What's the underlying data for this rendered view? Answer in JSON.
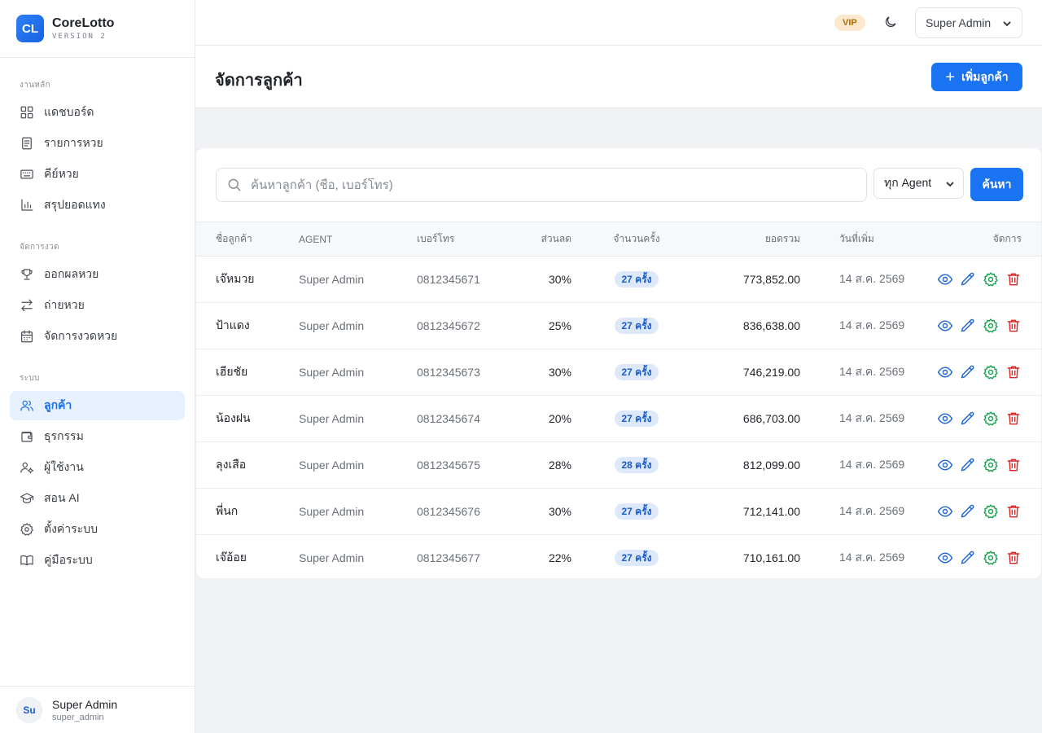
{
  "brand": {
    "logo": "CL",
    "name": "CoreLotto",
    "version": "VERSION 2"
  },
  "sidebar": {
    "sections": [
      {
        "title": "งานหลัก",
        "items": [
          {
            "label": "แดชบอร์ด",
            "icon": "dashboard-icon"
          },
          {
            "label": "รายการหวย",
            "icon": "document-icon"
          },
          {
            "label": "คีย์หวย",
            "icon": "keyboard-icon"
          },
          {
            "label": "สรุปยอดแทง",
            "icon": "bar-chart-icon"
          }
        ]
      },
      {
        "title": "จัดการงวด",
        "items": [
          {
            "label": "ออกผลหวย",
            "icon": "trophy-icon"
          },
          {
            "label": "ถ่ายหวย",
            "icon": "transfer-icon"
          },
          {
            "label": "จัดการงวดหวย",
            "icon": "calendar-icon"
          }
        ]
      },
      {
        "title": "ระบบ",
        "items": [
          {
            "label": "ลูกค้า",
            "icon": "users-icon",
            "active": true
          },
          {
            "label": "ธุรกรรม",
            "icon": "wallet-icon"
          },
          {
            "label": "ผู้ใช้งาน",
            "icon": "user-cog-icon"
          },
          {
            "label": "สอน AI",
            "icon": "graduation-cap-icon"
          },
          {
            "label": "ตั้งค่าระบบ",
            "icon": "gear-icon"
          },
          {
            "label": "คู่มือระบบ",
            "icon": "book-icon"
          }
        ]
      }
    ]
  },
  "footer_user": {
    "initials": "Su",
    "name": "Super Admin",
    "login": "super_admin"
  },
  "topbar": {
    "badge": "VIP",
    "user_menu": "Super Admin"
  },
  "page": {
    "title": "จัดการลูกค้า",
    "add_button": "เพิ่มลูกค้า"
  },
  "filters": {
    "search_placeholder": "ค้นหาลูกค้า (ชื่อ, เบอร์โทร)",
    "agent_selected": "ทุก Agent",
    "search_button": "ค้นหา"
  },
  "table": {
    "headers": [
      "ชื่อลูกค้า",
      "AGENT",
      "เบอร์โทร",
      "ส่วนลด",
      "จำนวนครั้ง",
      "ยอดรวม",
      "วันที่เพิ่ม",
      "จัดการ"
    ],
    "rows": [
      {
        "name": "เจ๊หมวย",
        "agent": "Super Admin",
        "phone": "0812345671",
        "discount": "30%",
        "count": "27 ครั้ง",
        "total": "773,852.00",
        "date": "14 ส.ค. 2569"
      },
      {
        "name": "ป้าแดง",
        "agent": "Super Admin",
        "phone": "0812345672",
        "discount": "25%",
        "count": "27 ครั้ง",
        "total": "836,638.00",
        "date": "14 ส.ค. 2569"
      },
      {
        "name": "เฮียชัย",
        "agent": "Super Admin",
        "phone": "0812345673",
        "discount": "30%",
        "count": "27 ครั้ง",
        "total": "746,219.00",
        "date": "14 ส.ค. 2569"
      },
      {
        "name": "น้องฝน",
        "agent": "Super Admin",
        "phone": "0812345674",
        "discount": "20%",
        "count": "27 ครั้ง",
        "total": "686,703.00",
        "date": "14 ส.ค. 2569"
      },
      {
        "name": "ลุงเสือ",
        "agent": "Super Admin",
        "phone": "0812345675",
        "discount": "28%",
        "count": "28 ครั้ง",
        "total": "812,099.00",
        "date": "14 ส.ค. 2569"
      },
      {
        "name": "พี่นก",
        "agent": "Super Admin",
        "phone": "0812345676",
        "discount": "30%",
        "count": "27 ครั้ง",
        "total": "712,141.00",
        "date": "14 ส.ค. 2569"
      },
      {
        "name": "เจ๊อ้อย",
        "agent": "Super Admin",
        "phone": "0812345677",
        "discount": "22%",
        "count": "27 ครั้ง",
        "total": "710,161.00",
        "date": "14 ส.ค. 2569"
      }
    ]
  },
  "colors": {
    "primary": "#1a73f0",
    "active_bg": "#e6f0ff",
    "vip_bg": "#fbe8cf",
    "settings_icon": "#16a34a",
    "delete_icon": "#dc2626"
  }
}
